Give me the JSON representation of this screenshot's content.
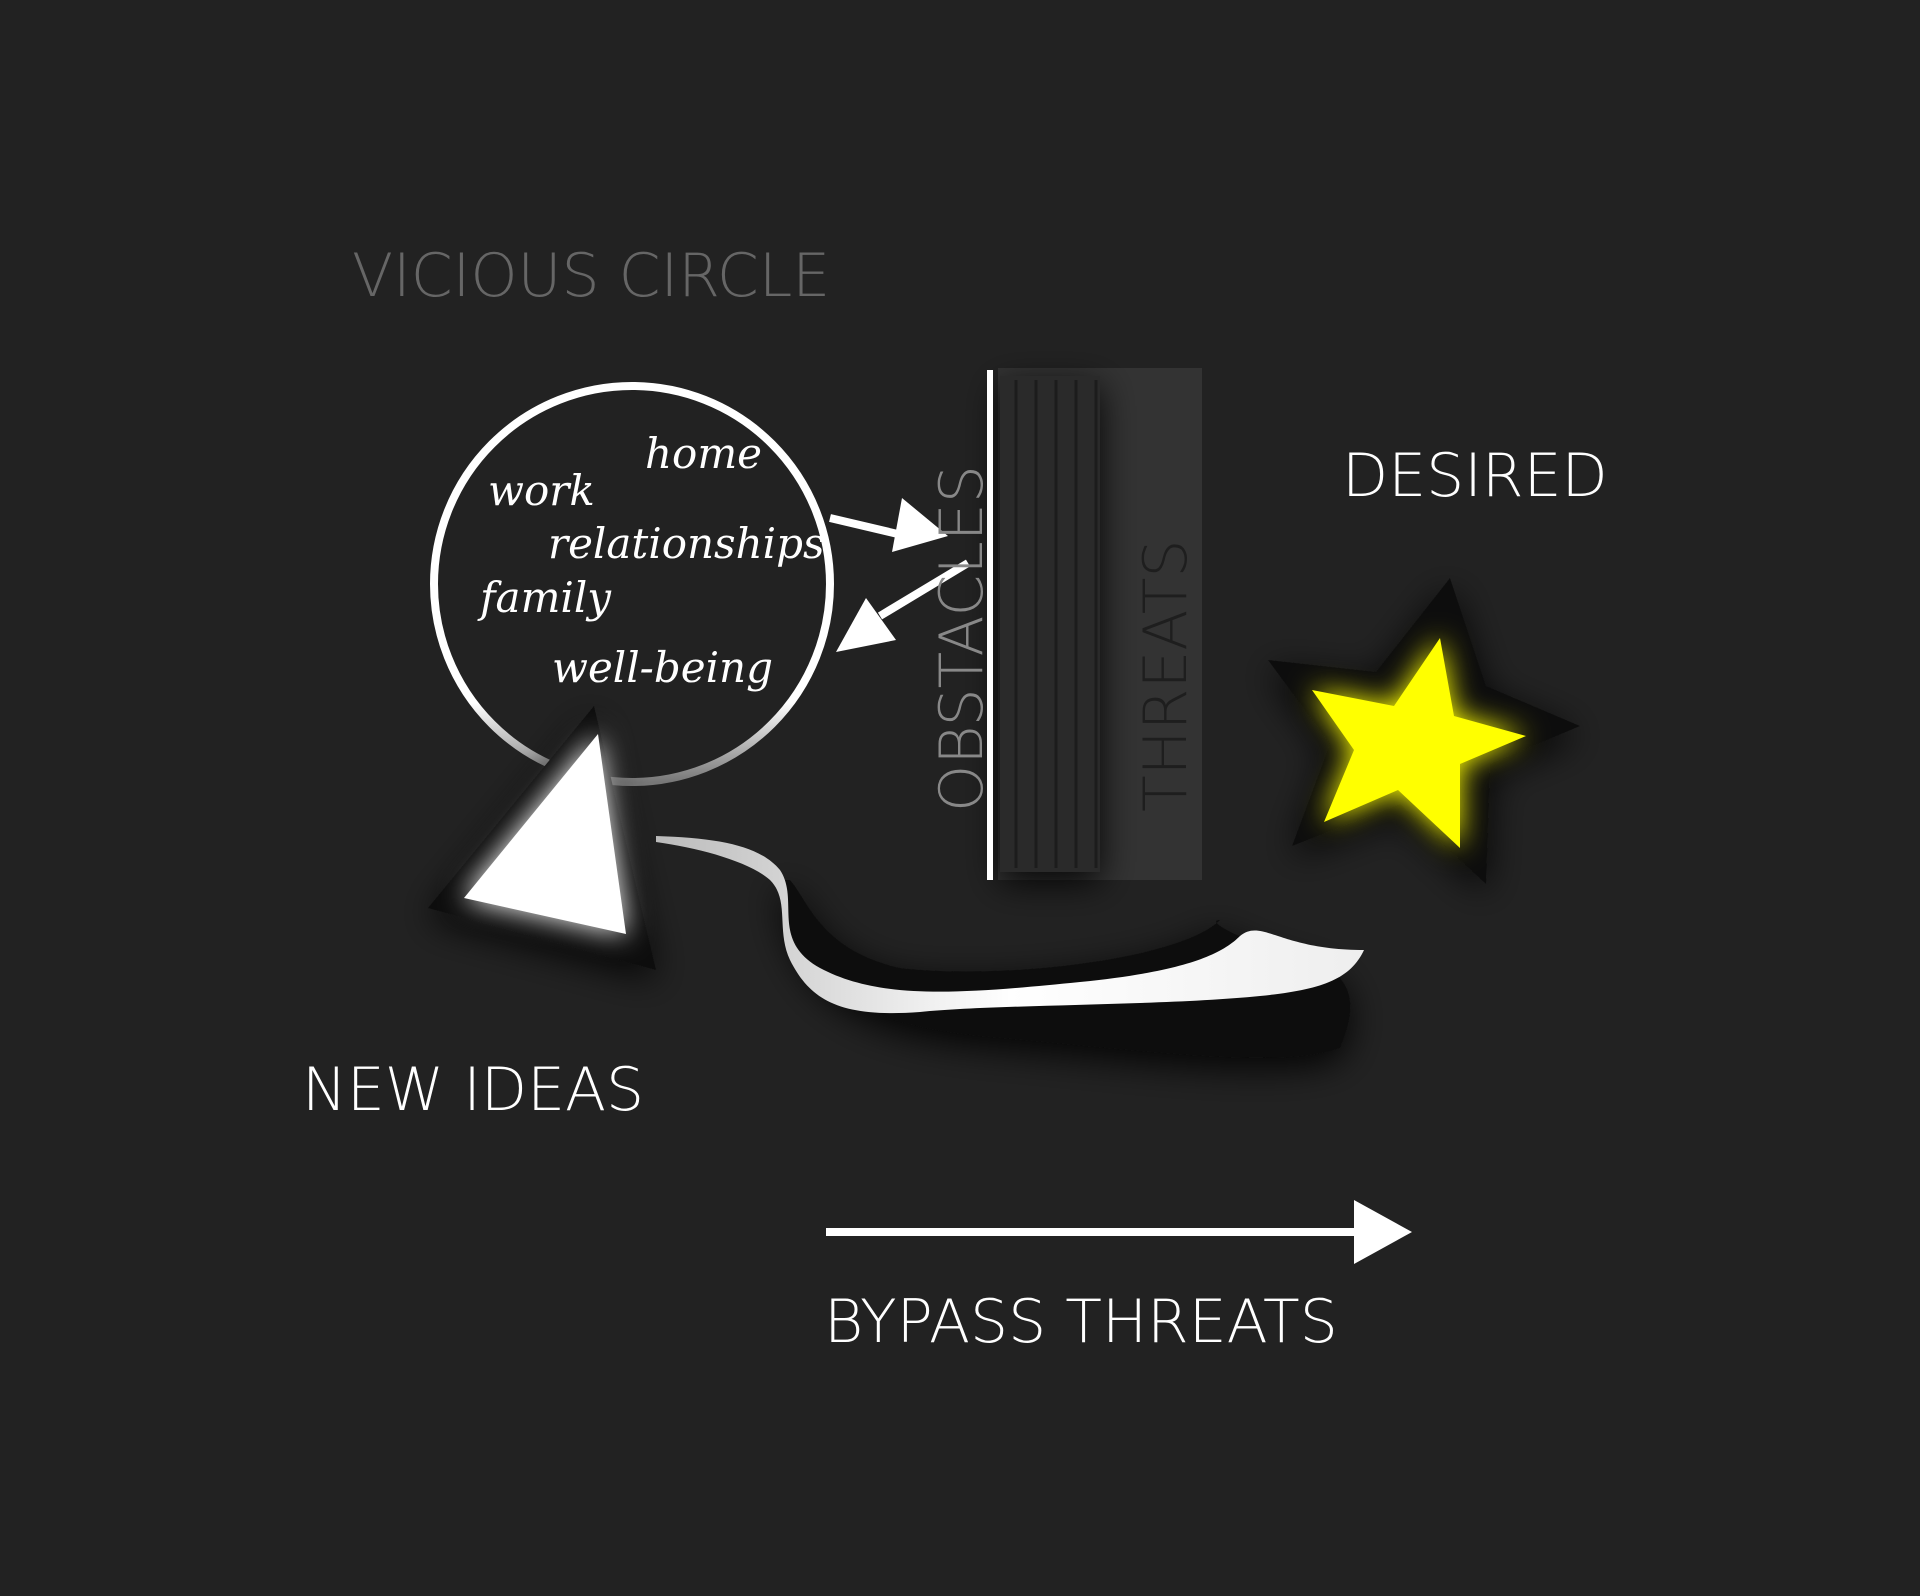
{
  "labels": {
    "vicious_circle": "VICIOUS CIRCLE",
    "desired": "DESIRED",
    "new_ideas": "NEW IDEAS",
    "bypass_threats": "BYPASS THREATS",
    "obstacles": "OBSTACLES",
    "threats": "THREATS"
  },
  "circle_words": {
    "home": "home",
    "work": "work",
    "relationships": "relationships",
    "family": "family",
    "well_being": "well-being"
  },
  "colors": {
    "background": "#222222",
    "primary": "#ffffff",
    "muted": "#666666",
    "star": "#ffff00",
    "wall": "#333333"
  }
}
